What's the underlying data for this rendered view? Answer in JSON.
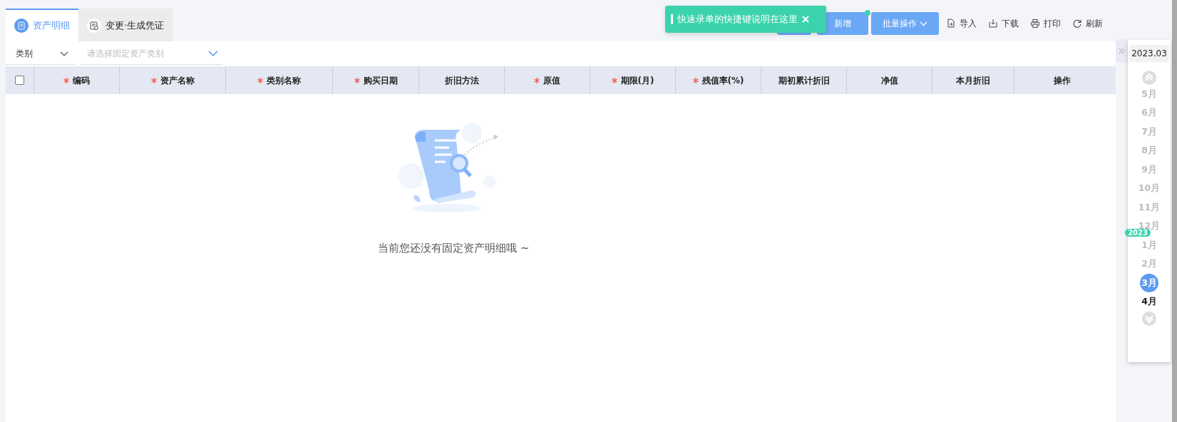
{
  "tabs": [
    {
      "label": "资产明细",
      "selected": true,
      "kind": "list"
    },
    {
      "label": "变更·生成凭证",
      "selected": false,
      "kind": "voucher"
    }
  ],
  "toolbar": [
    {
      "kind": "covered"
    },
    {
      "kind": "primary",
      "label": "新增",
      "dot": true
    },
    {
      "kind": "dropdown",
      "label": "批量操作"
    },
    {
      "kind": "import",
      "label": "导入"
    },
    {
      "kind": "download",
      "label": "下载"
    },
    {
      "kind": "print",
      "label": "打印"
    },
    {
      "kind": "refresh",
      "label": "刷新"
    }
  ],
  "toast": {
    "text": "快速录单的快捷键说明在这里"
  },
  "filters": {
    "category": {
      "value": "类别"
    },
    "asset_type": {
      "placeholder": "请选择固定资产类别"
    }
  },
  "table": {
    "select_all": {
      "checked": false
    },
    "columns": [
      {
        "label": "编码",
        "required": true
      },
      {
        "label": "资产名称",
        "required": true
      },
      {
        "label": "类别名称",
        "required": true
      },
      {
        "label": "购买日期",
        "required": true
      },
      {
        "label": "折旧方法",
        "required": false
      },
      {
        "label": "原值",
        "required": true
      },
      {
        "label": "期限(月)",
        "required": true
      },
      {
        "label": "残值率(%)",
        "required": true
      },
      {
        "label": "期初累计折旧",
        "required": false
      },
      {
        "label": "净值",
        "required": false
      },
      {
        "label": "本月折旧",
        "required": false
      },
      {
        "label": "操作",
        "required": false
      }
    ]
  },
  "empty_state": {
    "message": "当前您还没有固定资产明细哦 ~"
  },
  "period_panel": {
    "current": "2023.03",
    "months": [
      {
        "label": "5月",
        "disabled": true,
        "selected": false
      },
      {
        "label": "6月",
        "disabled": true,
        "selected": false
      },
      {
        "label": "7月",
        "disabled": true,
        "selected": false
      },
      {
        "label": "8月",
        "disabled": true,
        "selected": false
      },
      {
        "label": "9月",
        "disabled": true,
        "selected": false
      },
      {
        "label": "10月",
        "disabled": true,
        "selected": false
      },
      {
        "label": "11月",
        "disabled": true,
        "selected": false
      },
      {
        "label": "12月",
        "disabled": true,
        "selected": false
      },
      {
        "label": "1月",
        "disabled": true,
        "selected": false,
        "year_label": "2023"
      },
      {
        "label": "2月",
        "disabled": true,
        "selected": false
      },
      {
        "label": "3月",
        "disabled": false,
        "selected": true
      },
      {
        "label": "4月",
        "disabled": false,
        "selected": false
      }
    ]
  }
}
